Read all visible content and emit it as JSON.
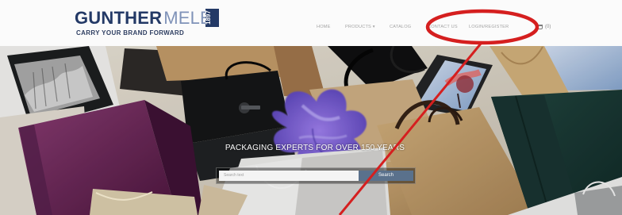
{
  "brand": {
    "name_bold": "GUNTHER",
    "name_light": "MELE",
    "year": "1897",
    "tagline": "CARRY YOUR BRAND FORWARD"
  },
  "nav": {
    "items": [
      {
        "label": "HOME"
      },
      {
        "label": "PRODUCTS ▾"
      },
      {
        "label": "CATALOG"
      },
      {
        "label": "CONTACT US"
      },
      {
        "label": "LOGIN/REGISTER"
      }
    ],
    "cart_icon": "shopping-bag-icon",
    "cart_count": "(0)"
  },
  "hero": {
    "headline": "PACKAGING EXPERTS FOR OVER 150 YEARS",
    "search": {
      "placeholder": "Search text",
      "value": "",
      "button_label": "Search"
    }
  },
  "annotation": {
    "color": "#d51f1f",
    "target": "LOGIN/REGISTER"
  }
}
